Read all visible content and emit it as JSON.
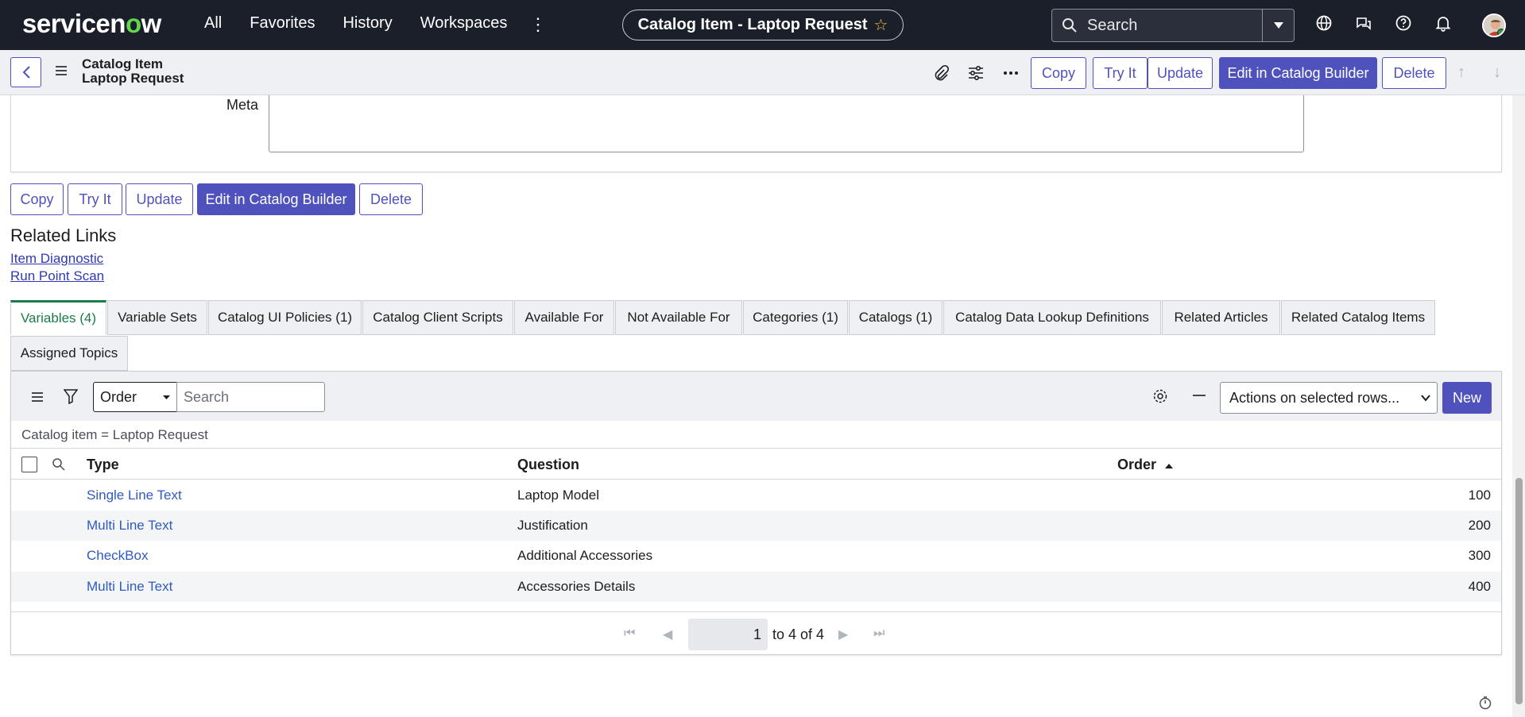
{
  "topnav": {
    "logo_left": "servicen",
    "logo_o": "o",
    "logo_right": "w",
    "links": [
      "All",
      "Favorites",
      "History",
      "Workspaces"
    ],
    "more": "⋮",
    "record_title": "Catalog Item - Laptop Request",
    "search_placeholder": "Search"
  },
  "form_header": {
    "line1": "Catalog Item",
    "line2": "Laptop Request",
    "buttons": {
      "copy": "Copy",
      "try_it": "Try It",
      "update": "Update",
      "edit_catalog_builder": "Edit in Catalog Builder",
      "delete": "Delete"
    }
  },
  "meta": {
    "label": "Meta",
    "value": ""
  },
  "bottom_buttons": {
    "copy": "Copy",
    "try_it": "Try It",
    "update": "Update",
    "edit_catalog_builder": "Edit in Catalog Builder",
    "delete": "Delete"
  },
  "related_links": {
    "title": "Related Links",
    "items": [
      "Item Diagnostic",
      "Run Point Scan"
    ]
  },
  "tabs": [
    "Variables (4)",
    "Variable Sets",
    "Catalog UI Policies (1)",
    "Catalog Client Scripts",
    "Available For",
    "Not Available For",
    "Categories (1)",
    "Catalogs (1)",
    "Catalog Data Lookup Definitions",
    "Related Articles",
    "Related Catalog Items",
    "Assigned Topics"
  ],
  "list": {
    "field_select": "Order",
    "search_placeholder": "Search",
    "actions_select": "Actions on selected rows...",
    "new_button": "New",
    "breadcrumb": "Catalog item = Laptop Request",
    "columns": {
      "type": "Type",
      "question": "Question",
      "order": "Order"
    },
    "rows": [
      {
        "type": "Single Line Text",
        "question": "Laptop Model",
        "order": "100"
      },
      {
        "type": "Multi Line Text",
        "question": "Justification",
        "order": "200"
      },
      {
        "type": "CheckBox",
        "question": "Additional Accessories",
        "order": "300"
      },
      {
        "type": "Multi Line Text",
        "question": "Accessories Details",
        "order": "400"
      }
    ],
    "pager": {
      "page": "1",
      "range": "to 4 of 4"
    }
  }
}
